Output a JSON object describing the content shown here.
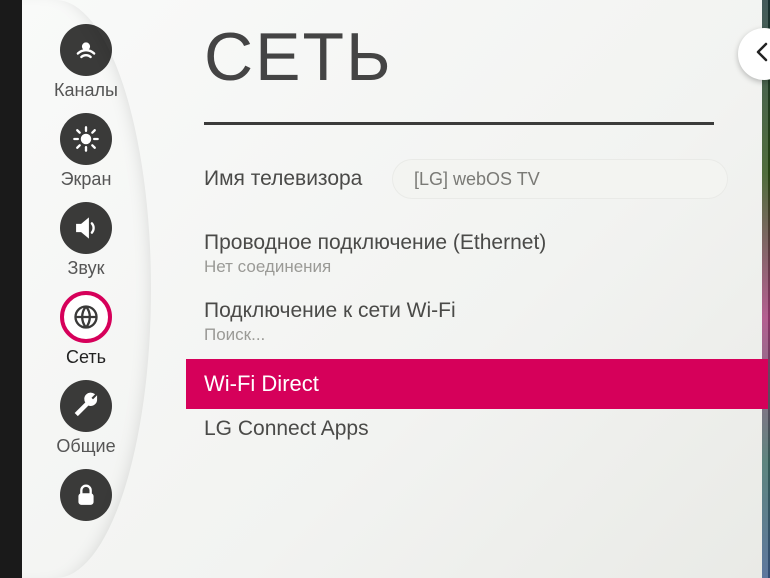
{
  "header": {
    "title": "СЕТЬ"
  },
  "sidebar": {
    "items": [
      {
        "label": "Каналы",
        "icon": "satellite-icon",
        "selected": false
      },
      {
        "label": "Экран",
        "icon": "brightness-icon",
        "selected": false
      },
      {
        "label": "Звук",
        "icon": "speaker-icon",
        "selected": false
      },
      {
        "label": "Сеть",
        "icon": "globe-icon",
        "selected": true
      },
      {
        "label": "Общие",
        "icon": "wrench-icon",
        "selected": false
      },
      {
        "label": "",
        "icon": "lock-icon",
        "selected": false
      }
    ]
  },
  "main": {
    "tvname": {
      "label": "Имя телевизора",
      "value": "[LG] webOS TV"
    },
    "items": [
      {
        "title": "Проводное подключение (Ethernet)",
        "subtitle": "Нет соединения",
        "highlighted": false
      },
      {
        "title": "Подключение к сети Wi-Fi",
        "subtitle": "Поиск...",
        "highlighted": false
      },
      {
        "title": "Wi-Fi Direct",
        "subtitle": "",
        "highlighted": true
      },
      {
        "title": "LG Connect Apps",
        "subtitle": "",
        "highlighted": false
      }
    ]
  },
  "back_button": {
    "label": "back"
  }
}
